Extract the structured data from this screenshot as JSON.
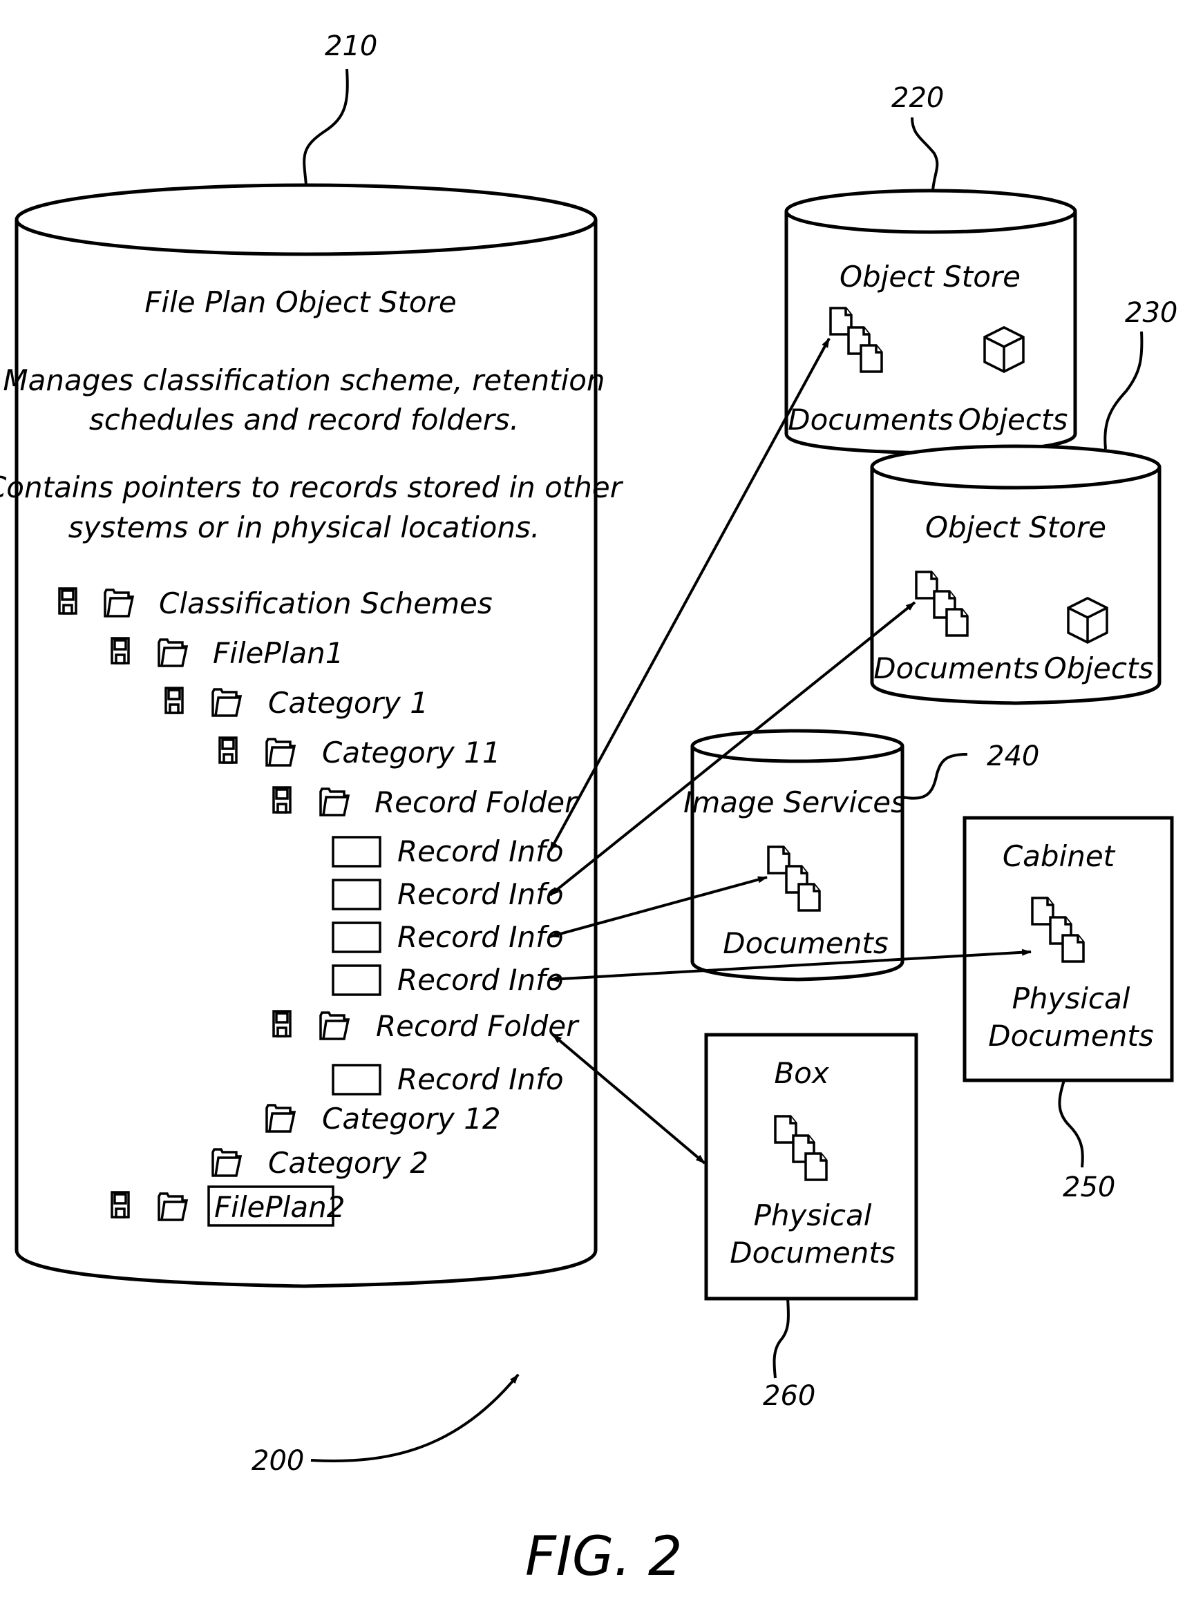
{
  "figure_label": "FIG. 2",
  "figure_ref": "200",
  "file_plan_store": {
    "ref": "210",
    "title": "File Plan Object Store",
    "desc1_line1": "Manages classification scheme, retention",
    "desc1_line2": "schedules and record folders.",
    "desc2_line1": "Contains pointers to records stored in other",
    "desc2_line2": "systems or in physical locations.",
    "tree": [
      {
        "label": "Classification Schemes",
        "icons": [
          "disk-icon",
          "folder-icon"
        ]
      },
      {
        "label": "FilePlan1",
        "icons": [
          "disk-icon",
          "folder-icon"
        ]
      },
      {
        "label": "Category 1",
        "icons": [
          "disk-icon",
          "folder-icon"
        ]
      },
      {
        "label": "Category 11",
        "icons": [
          "disk-icon",
          "folder-icon"
        ]
      },
      {
        "label": "Record Folder",
        "icons": [
          "disk-icon",
          "folder-icon"
        ]
      },
      {
        "label": "Record Info",
        "icons": [
          "record-icon"
        ]
      },
      {
        "label": "Record Info",
        "icons": [
          "record-icon"
        ]
      },
      {
        "label": "Record Info",
        "icons": [
          "record-icon"
        ]
      },
      {
        "label": "Record Info",
        "icons": [
          "record-icon"
        ]
      },
      {
        "label": "Record Folder",
        "icons": [
          "disk-icon",
          "folder-icon"
        ]
      },
      {
        "label": "Record Info",
        "icons": [
          "record-icon"
        ]
      },
      {
        "label": "Category 12",
        "icons": [
          "folder-icon"
        ]
      },
      {
        "label": "Category 2",
        "icons": [
          "folder-icon"
        ]
      },
      {
        "label": "FilePlan2",
        "icons": [
          "disk-icon",
          "folder-icon"
        ],
        "selected": true
      }
    ]
  },
  "object_store_1": {
    "ref": "220",
    "title": "Object Store",
    "documents": "Documents",
    "objects": "Objects"
  },
  "object_store_2": {
    "ref": "230",
    "title": "Object Store",
    "documents": "Documents",
    "objects": "Objects"
  },
  "image_services": {
    "ref": "240",
    "title": "Image Services",
    "documents": "Documents"
  },
  "cabinet": {
    "ref": "250",
    "title": "Cabinet",
    "docs_line1": "Physical",
    "docs_line2": "Documents"
  },
  "box": {
    "ref": "260",
    "title": "Box",
    "docs_line1": "Physical",
    "docs_line2": "Documents"
  }
}
